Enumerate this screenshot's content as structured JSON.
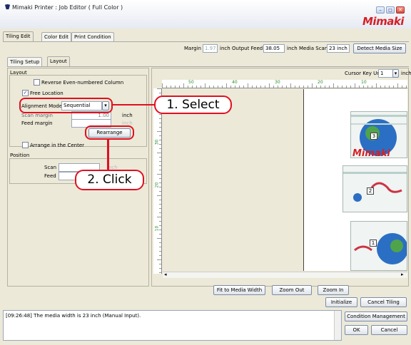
{
  "window": {
    "title": "Mimaki Printer : Job Editor ( Full Color )",
    "minimize": "–",
    "maximize": "◻",
    "close": "✕",
    "brand": "Mimaki"
  },
  "main_tabs": [
    "Tiling Edit",
    "Color Edit",
    "Print Condition"
  ],
  "media": {
    "margin_label": "Margin",
    "margin_value": "1.97",
    "margin_unit": "inch",
    "feed_label": "Output Feed",
    "feed_value": "38.05",
    "feed_unit": "inch",
    "scan_label": "Media Scan",
    "scan_value": "23 inch",
    "detect_button": "Detect Media Size"
  },
  "sub_tabs": [
    "Tiling Setup",
    "Layout"
  ],
  "layout": {
    "group_title": "Layout",
    "reverse_label": "Reverse Even-numbered Column",
    "reverse_checked": "",
    "free_label": "Free Location",
    "free_checked": "✓",
    "alignment_label": "Alignment Mode",
    "alignment_value": "Sequential",
    "scan_margin_label": "Scan margin",
    "scan_margin_value": "1.00",
    "scan_margin_unit": "inch",
    "feed_margin_label": "Feed margin",
    "feed_margin_value": "",
    "feed_margin_unit": "inch",
    "rearrange_button": "Rearrange",
    "center_label": "Arrange in the Center",
    "center_checked": ""
  },
  "position": {
    "group_title": "Position",
    "scan_label": "Scan",
    "scan_value": "",
    "scan_unit": "inch",
    "feed_label": "Feed",
    "feed_value": "",
    "feed_unit": "inch"
  },
  "preview": {
    "cursor_key_label": "Cursor Key Unit",
    "cursor_key_value": "1",
    "cursor_key_unit": "inch",
    "ruler_h": [
      "50",
      "40",
      "30",
      "20",
      "10"
    ],
    "ruler_v": [
      "30",
      "20",
      "10"
    ],
    "tile_numbers": [
      "3",
      "2",
      "1"
    ],
    "brand_on_tile": "Mimaki",
    "fit_button": "Fit to Media Width",
    "zoom_out_button": "Zoom Out",
    "zoom_in_button": "Zoom In"
  },
  "actions": {
    "initialize_button": "Initialize",
    "cancel_tiling_button": "Cancel Tiling",
    "condition_button": "Condition Management",
    "ok_button": "OK",
    "cancel_button": "Cancel"
  },
  "log": {
    "message": "[09:26:48] The media width is 23 inch (Manual Input)."
  },
  "callouts": {
    "select": "1. Select",
    "click": "2. Click"
  },
  "colors": {
    "callout_red": "#e01020",
    "brand_red": "#d51f26",
    "window_face": "#ece9d8",
    "ruler_number_green": "#2a8c2a"
  }
}
